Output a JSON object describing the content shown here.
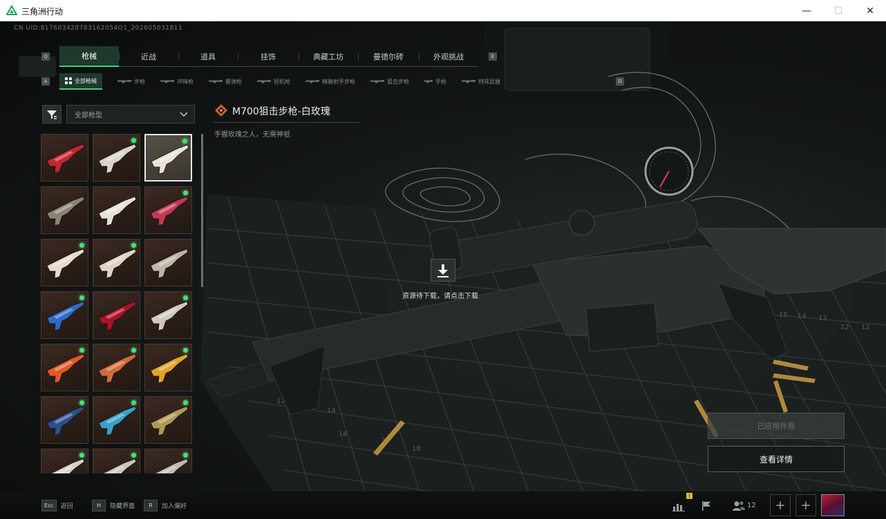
{
  "window": {
    "title": "三角洲行动",
    "minimize_glyph": "—",
    "maximize_glyph": "☐",
    "close_glyph": "✕"
  },
  "uid_text": "CN UID:817603428783162054O1_202605031811",
  "main_tabs": {
    "left_key": "Q",
    "right_key": "E",
    "items": [
      {
        "label": "枪械",
        "active": true
      },
      {
        "label": "近战",
        "active": false
      },
      {
        "label": "道具",
        "active": false
      },
      {
        "label": "挂饰",
        "active": false
      },
      {
        "label": "典藏工坊",
        "active": false
      },
      {
        "label": "曼德尔砖",
        "active": false
      },
      {
        "label": "外观挑战",
        "active": false
      }
    ]
  },
  "sub_tabs": {
    "left_key": "A",
    "right_key": "D",
    "items": [
      {
        "label": "全部枪械",
        "active": true
      },
      {
        "label": "步枪",
        "active": false
      },
      {
        "label": "冲锋枪",
        "active": false
      },
      {
        "label": "霰弹枪",
        "active": false
      },
      {
        "label": "轻机枪",
        "active": false
      },
      {
        "label": "精确射手步枪",
        "active": false
      },
      {
        "label": "狙击步枪",
        "active": false
      },
      {
        "label": "手枪",
        "active": false
      },
      {
        "label": "特殊武器",
        "active": false
      }
    ]
  },
  "filter": {
    "icon": "filter-icon",
    "dropdown_value": "全部枪型"
  },
  "skin_grid": {
    "rows": [
      [
        {
          "owned": false,
          "selected": false,
          "color": "#c2262e"
        },
        {
          "owned": true,
          "selected": false,
          "color": "#d8d4cc"
        },
        {
          "owned": true,
          "selected": true,
          "color": "#e8e4dc"
        }
      ],
      [
        {
          "owned": false,
          "selected": false,
          "color": "#8a8478"
        },
        {
          "owned": false,
          "selected": false,
          "color": "#e6e2da"
        },
        {
          "owned": true,
          "selected": false,
          "color": "#c23a52"
        }
      ],
      [
        {
          "owned": true,
          "selected": false,
          "color": "#e4dccc"
        },
        {
          "owned": true,
          "selected": false,
          "color": "#ddd4c2"
        },
        {
          "owned": false,
          "selected": false,
          "color": "#bdb5a8"
        }
      ],
      [
        {
          "owned": true,
          "selected": false,
          "color": "#2f6ac8"
        },
        {
          "owned": false,
          "selected": false,
          "color": "#a8142a"
        },
        {
          "owned": true,
          "selected": false,
          "color": "#cfc9c0"
        }
      ],
      [
        {
          "owned": true,
          "selected": false,
          "color": "#e05a26"
        },
        {
          "owned": true,
          "selected": false,
          "color": "#d26a3a"
        },
        {
          "owned": true,
          "selected": false,
          "color": "#e0a428"
        }
      ],
      [
        {
          "owned": true,
          "selected": false,
          "color": "#2c4e8a"
        },
        {
          "owned": true,
          "selected": false,
          "color": "#3aa0c6"
        },
        {
          "owned": true,
          "selected": false,
          "color": "#b09a58"
        }
      ],
      [
        {
          "owned": true,
          "selected": false,
          "color": "#d8d2c8"
        },
        {
          "owned": true,
          "selected": false,
          "color": "#cac4ba"
        },
        {
          "owned": true,
          "selected": false,
          "color": "#bfb9ae"
        }
      ]
    ]
  },
  "item": {
    "name": "M700狙击步枪-白玫瑰",
    "description": "手握玫瑰之人，无需神祇",
    "rarity_icon": "rarity-diamond-icon"
  },
  "download": {
    "icon": "download-icon",
    "text": "资源待下载，请点击下载"
  },
  "actions": {
    "applied_label": "已应用外观",
    "details_label": "查看详情"
  },
  "bottom_hints": [
    {
      "key": "Esc",
      "label": "返回"
    },
    {
      "key": "H",
      "label": "隐藏界面"
    },
    {
      "key": "R",
      "label": "加入偏好"
    }
  ],
  "bottom_right": {
    "stats_badge": "!",
    "friends_count": "12",
    "plus_glyph": "+"
  },
  "colors": {
    "accent_green": "#3fd07a",
    "owned_dot": "#46e07a"
  }
}
